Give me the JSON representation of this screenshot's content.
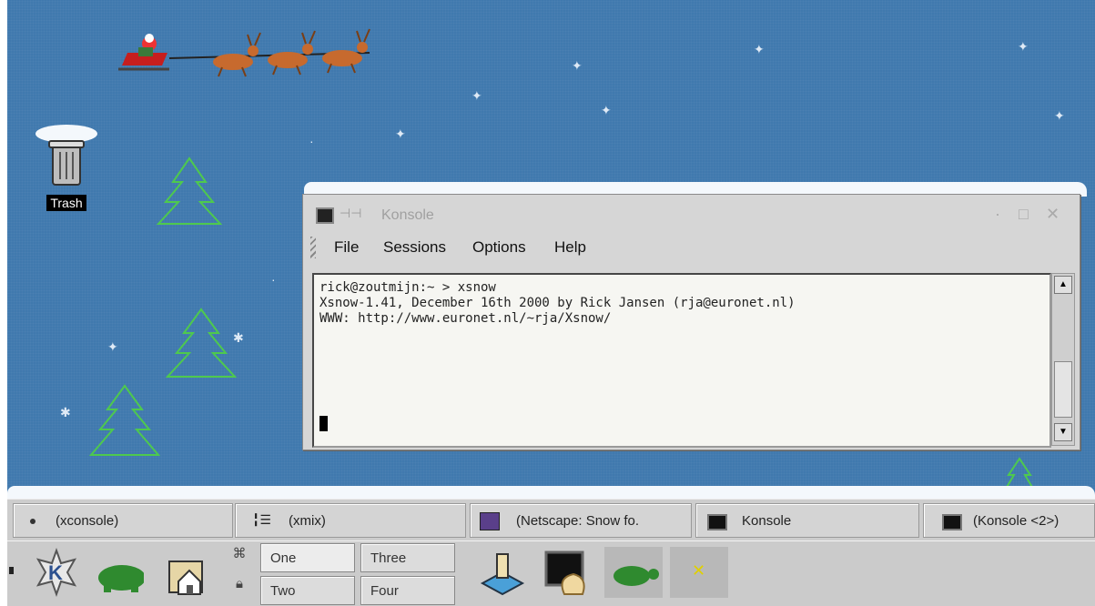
{
  "desktop": {
    "icons": [
      {
        "label": "Trash",
        "icon": "trash-icon"
      }
    ]
  },
  "konsole": {
    "title": "Konsole",
    "menu": [
      "File",
      "Sessions",
      "Options",
      "Help"
    ],
    "terminal_lines": [
      "rick@zoutmijn:~ > xsnow",
      "Xsnow-1.41, December 16th 2000 by Rick Jansen (rja@euronet.nl)",
      "WWW: http://www.euronet.nl/~rja/Xsnow/"
    ]
  },
  "taskbar": {
    "tasks": [
      {
        "label": "(xconsole)",
        "icon": "dot-icon"
      },
      {
        "label": "(xmix)",
        "icon": "mixer-icon"
      },
      {
        "label": "(Netscape: Snow fo.",
        "icon": "netscape-icon"
      },
      {
        "label": "Konsole",
        "icon": "terminal-icon"
      },
      {
        "label": "(Konsole <2>)",
        "icon": "terminal-icon"
      }
    ]
  },
  "panel": {
    "desktops": [
      "One",
      "Three",
      "Two",
      "Four"
    ],
    "active_desktop": "One",
    "launchers": [
      "kde-menu-icon",
      "turtle-icon",
      "home-folder-icon",
      "install-icon",
      "shell-icon",
      "turtle-icon",
      "x-icon"
    ]
  },
  "colors": {
    "desktop": "#4079ae",
    "tree": "#4ec94e",
    "panel": "#cbcbcb"
  }
}
